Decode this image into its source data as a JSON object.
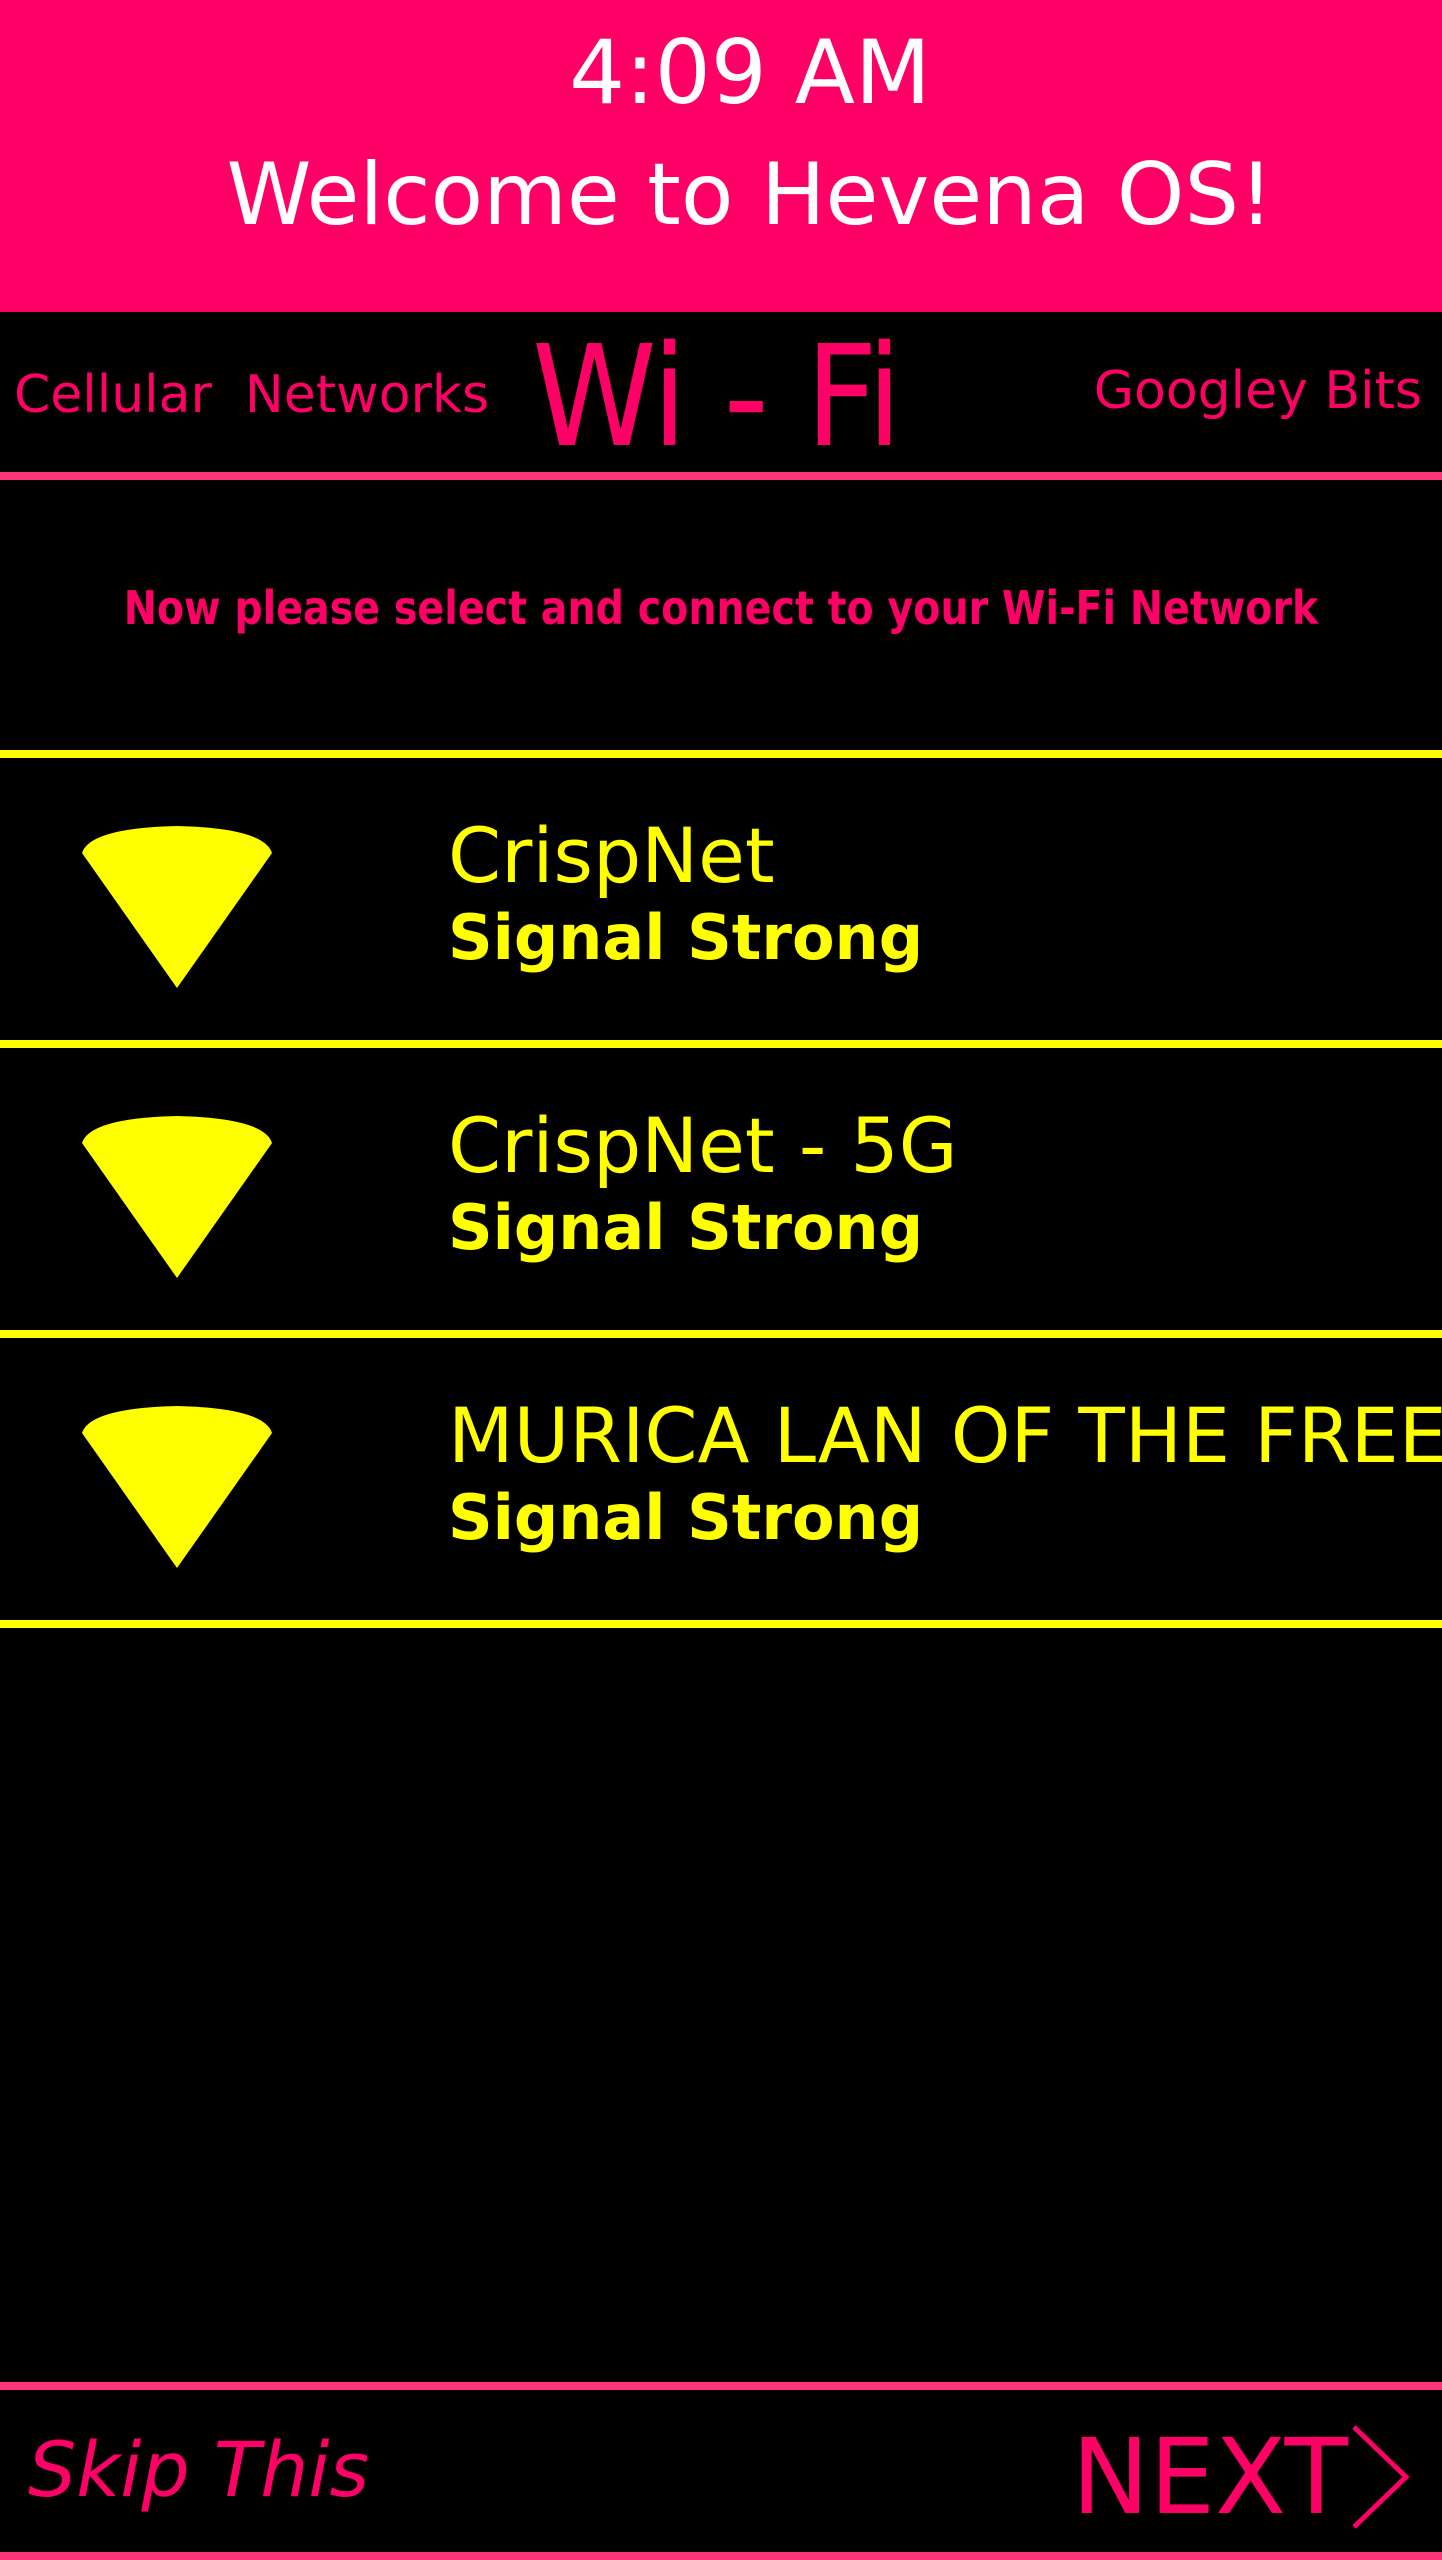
{
  "header": {
    "time": "4:09 AM",
    "welcome": "Welcome to Hevena OS!"
  },
  "tabs": {
    "left": "Cellular  Networks",
    "center": "Wi - Fi",
    "right": "Googley Bits"
  },
  "instruction": "Now please select and connect to your Wi-Fi Network",
  "networks": [
    {
      "name": "CrispNet",
      "signal": "Signal Strong",
      "icon": "wifi-icon"
    },
    {
      "name": "CrispNet - 5G",
      "signal": "Signal Strong",
      "icon": "wifi-icon"
    },
    {
      "name": "MURICA LAN OF THE FREE",
      "signal": "Signal Strong",
      "icon": "wifi-icon"
    }
  ],
  "footer": {
    "skip": "Skip This",
    "next": "NEXT",
    "next_icon": "chevron-right-icon"
  },
  "colors": {
    "accent": "#ff0066",
    "highlight": "#ffff00",
    "background": "#000000",
    "header_text": "#ffffff"
  }
}
